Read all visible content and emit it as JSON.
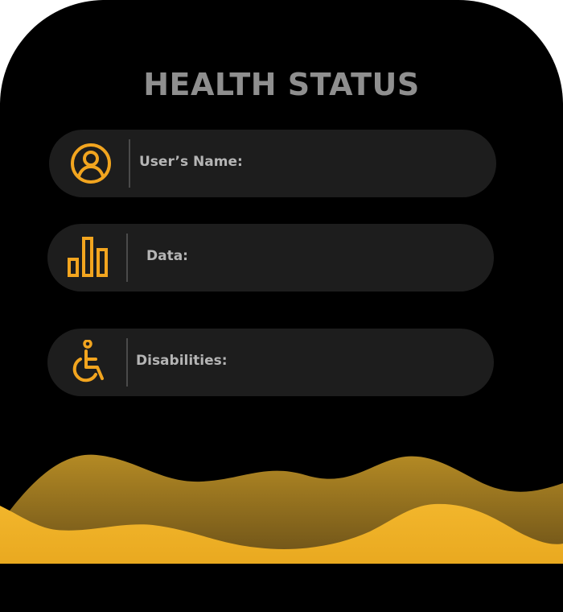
{
  "screen": {
    "title": "HEALTH STATUS"
  },
  "fields": [
    {
      "label": "User’s Name:",
      "icon": "user-circle-icon"
    },
    {
      "label": "Data:",
      "icon": "bar-chart-icon"
    },
    {
      "label": "Disabilities:",
      "icon": "wheelchair-icon"
    }
  ],
  "colors": {
    "background": "#000000",
    "card": "#1d1d1d",
    "accent": "#f2a51f",
    "title": "#8f8f8f",
    "label": "#b5b5b5",
    "wave_back": "#b48a24",
    "wave_front": "#f0b22a"
  }
}
